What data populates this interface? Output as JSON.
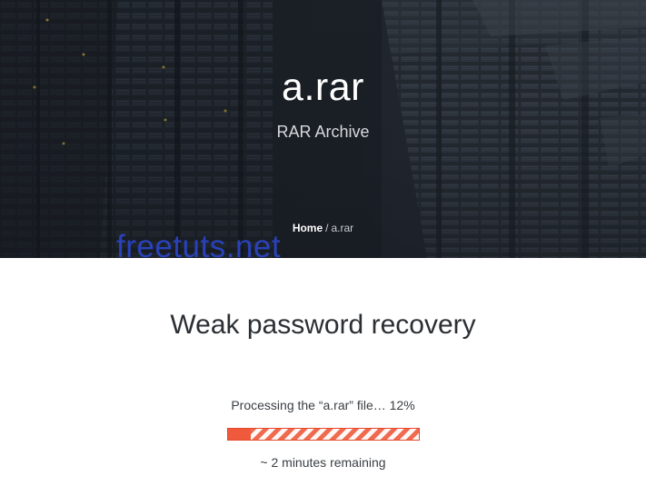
{
  "hero": {
    "title": "a.rar",
    "subtitle": "RAR Archive"
  },
  "breadcrumb": {
    "home": "Home",
    "separator": "/",
    "current": "a.rar"
  },
  "watermark": "freetuts.net",
  "main": {
    "title": "Weak password recovery",
    "status": "Processing the “a.rar” file… 12%",
    "remaining": "~ 2 minutes remaining",
    "progress": {
      "fraction": 0.12,
      "accent_color": "#e5482b"
    }
  }
}
